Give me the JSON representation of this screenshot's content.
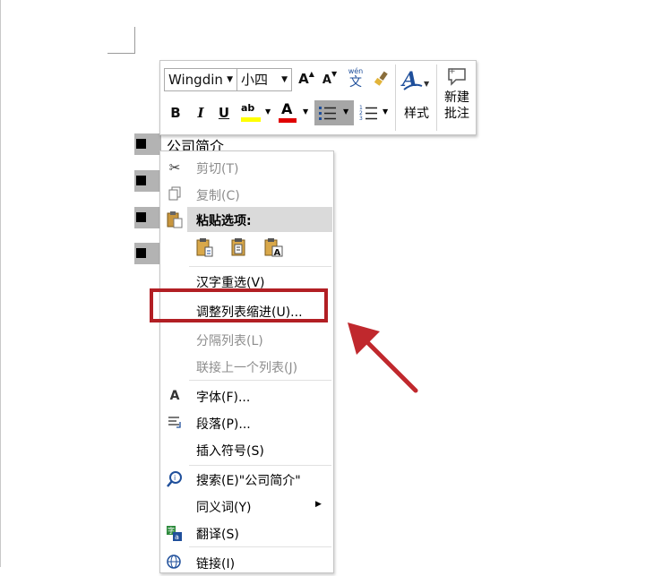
{
  "document": {
    "list_first_item": "公司简介"
  },
  "mini_toolbar": {
    "font_name": "Wingdin",
    "font_size": "小四",
    "grow_font": "A",
    "shrink_font": "A",
    "phonetic_top": "wén",
    "phonetic_char": "文",
    "bold": "B",
    "italic": "I",
    "underline": "U",
    "highlight_letters": "ab",
    "font_color_letter": "A",
    "styles_label": "样式",
    "new_comment_line1": "新建",
    "new_comment_line2": "批注"
  },
  "context_menu": {
    "items": [
      {
        "label": "剪切(T)",
        "enabled": false,
        "icon": "scissors-icon"
      },
      {
        "label": "复制(C)",
        "enabled": false,
        "icon": "copy-icon"
      },
      {
        "label": "粘贴选项:",
        "enabled": true,
        "icon": "paste-icon"
      },
      {
        "label": "汉字重选(V)",
        "enabled": true
      },
      {
        "label": "调整列表缩进(U)...",
        "enabled": true,
        "highlighted": true
      },
      {
        "label": "分隔列表(L)",
        "enabled": false
      },
      {
        "label": "联接上一个列表(J)",
        "enabled": false
      },
      {
        "label": "字体(F)...",
        "enabled": true,
        "icon": "font-icon"
      },
      {
        "label": "段落(P)...",
        "enabled": true,
        "icon": "paragraph-icon"
      },
      {
        "label": "插入符号(S)",
        "enabled": true
      },
      {
        "label": "搜索(E)\"公司简介\"",
        "enabled": true,
        "icon": "smart-lookup-icon"
      },
      {
        "label": "同义词(Y)",
        "enabled": true,
        "submenu": true
      },
      {
        "label": "翻译(S)",
        "enabled": true,
        "icon": "translate-icon"
      },
      {
        "label": "链接(I)",
        "enabled": true,
        "icon": "link-icon"
      }
    ],
    "paste_glyph": "A"
  },
  "colors": {
    "highlight_box": "#b21f24",
    "arrow": "#c0282d",
    "highlighter_yellow": "#ffff00",
    "font_color_red": "#e00000",
    "selection_gray": "#b3b3b3"
  }
}
